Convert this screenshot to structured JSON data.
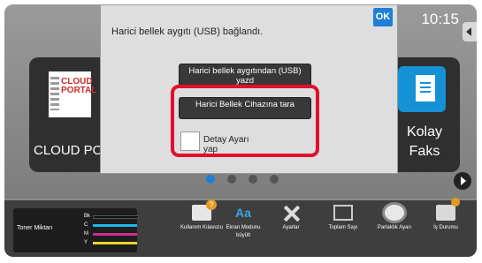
{
  "clock": "10:15",
  "tiles": {
    "left_label": "CLOUD POR",
    "cloud_logo_text": "CLOUD PORTAL",
    "right_label_line1": "Kolay",
    "right_label_line2": "Faks"
  },
  "dialog": {
    "message": "Harici bellek aygıtı (USB) bağlandı.",
    "ok_label": "OK",
    "option1": "Harici bellek aygıtından (USB) yazd",
    "option2": "Harici Bellek Cihazına tara",
    "detail_label": "Detay Ayarı yap"
  },
  "page_dots": 4,
  "bottom_bar": {
    "toner_label": "Toner Miktarı",
    "toner": [
      {
        "name": "Bk",
        "color": "#111111"
      },
      {
        "name": "C",
        "color": "#1fb6e8"
      },
      {
        "name": "M",
        "color": "#d22c8e"
      },
      {
        "name": "Y",
        "color": "#e9d52a"
      }
    ],
    "items": [
      {
        "label": "Kullanım Kılavuzu",
        "icon": "manual-icon"
      },
      {
        "label": "Ekran Modunu büyült",
        "icon": "zoom-text-icon"
      },
      {
        "label": "Ayarlar",
        "icon": "tools-icon"
      },
      {
        "label": "Toplam Sayı",
        "icon": "counter-icon"
      },
      {
        "label": "Parlaklık Ayarı",
        "icon": "brightness-icon"
      },
      {
        "label": "İş Durumu",
        "icon": "job-status-icon"
      }
    ]
  }
}
